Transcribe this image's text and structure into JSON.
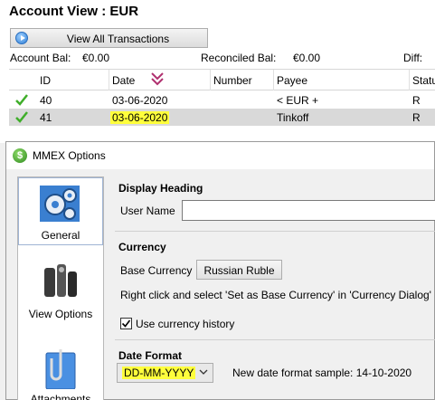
{
  "account": {
    "title": "Account View : EUR",
    "view_all_label": "View All Transactions",
    "account_bal_label": "Account Bal:",
    "account_bal_value": "€0.00",
    "reconciled_bal_label": "Reconciled Bal:",
    "reconciled_bal_value": "€0.00",
    "diff_label": "Diff:",
    "columns": [
      "ID",
      "Date",
      "Number",
      "Payee",
      "Status"
    ],
    "rows": [
      {
        "status_icon": "check-icon",
        "id": "40",
        "date": "03-06-2020",
        "number": "",
        "payee": "< EUR +",
        "status": "R"
      },
      {
        "status_icon": "check-icon",
        "id": "41",
        "date": "03-06-2020",
        "number": "",
        "payee": "Tinkoff",
        "status": "R"
      }
    ],
    "highlight_color": "#ffff3c"
  },
  "dialog": {
    "title": "MMEX Options",
    "sidebar": [
      {
        "label": "General",
        "icon": "gears-icon",
        "active": true
      },
      {
        "label": "View Options",
        "icon": "view-options-icon",
        "active": false
      },
      {
        "label": "Attachments",
        "icon": "attachments-icon",
        "active": false
      }
    ],
    "display_heading": {
      "title": "Display Heading",
      "user_name_label": "User Name",
      "user_name_value": ""
    },
    "currency": {
      "title": "Currency",
      "base_currency_label": "Base Currency",
      "base_currency_button": "Russian Ruble",
      "hint": "Right click and select 'Set as Base Currency' in 'Currency Dialog'",
      "use_history_label": "Use currency history",
      "use_history_checked": true
    },
    "date_format": {
      "title": "Date Format",
      "selected": "DD-MM-YYYY",
      "sample_label": "New date format sample: 14-10-2020"
    }
  }
}
